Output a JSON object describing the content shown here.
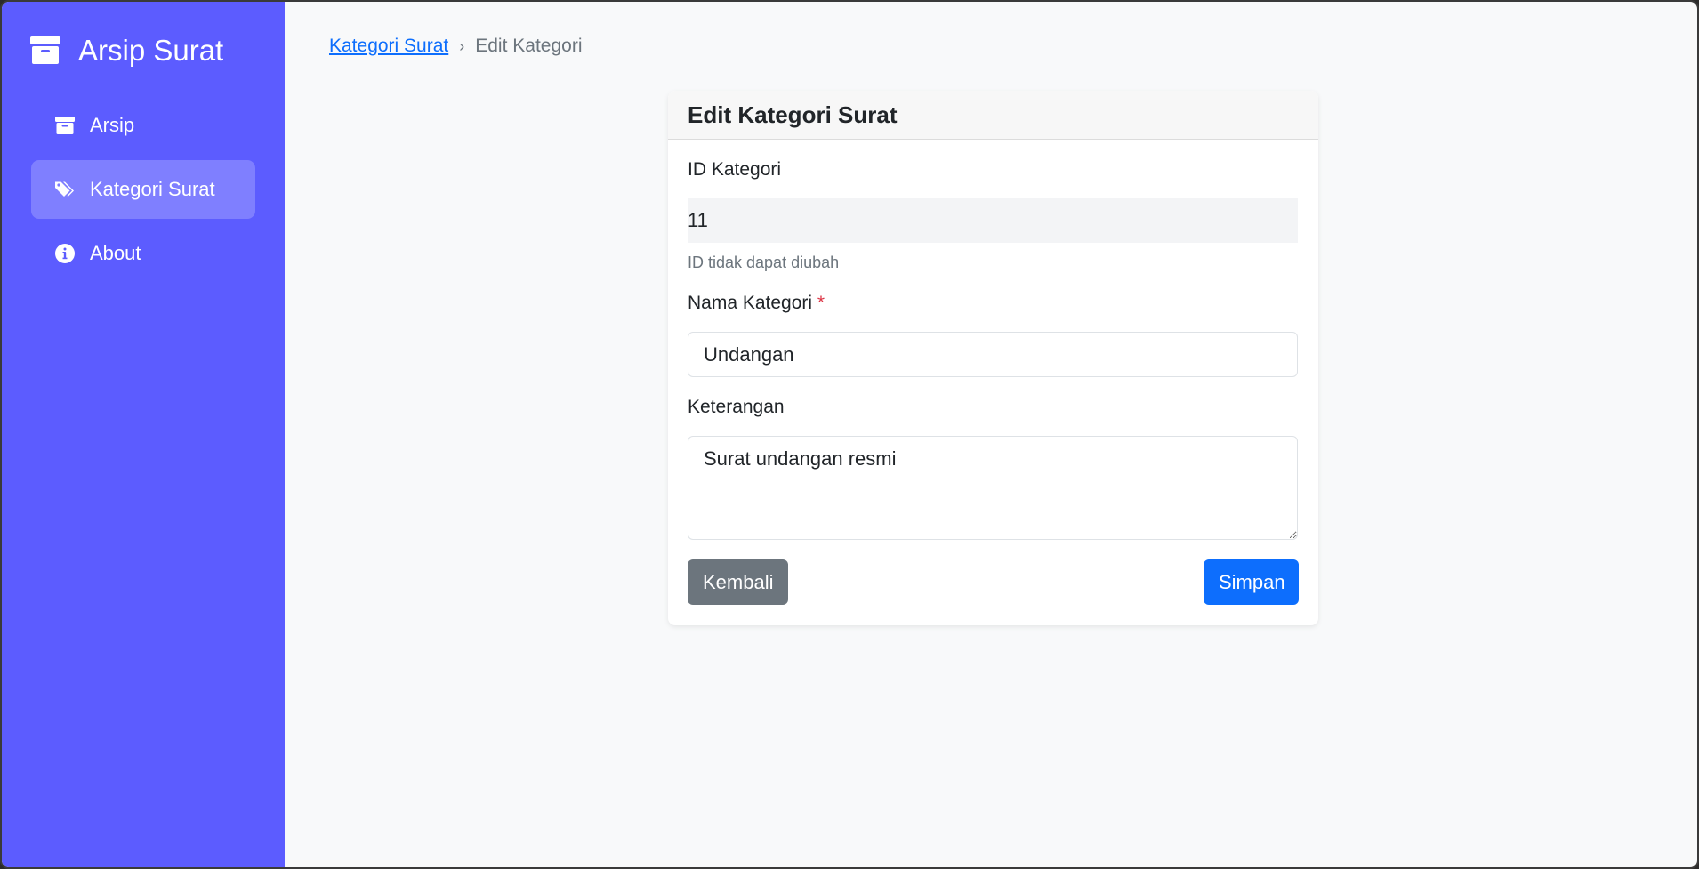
{
  "sidebar": {
    "brand": "Arsip Surat",
    "items": [
      {
        "label": "Arsip",
        "icon": "archive-icon",
        "active": false
      },
      {
        "label": "Kategori Surat",
        "icon": "tags-icon",
        "active": true
      },
      {
        "label": "About",
        "icon": "info-icon",
        "active": false
      }
    ]
  },
  "breadcrumb": {
    "parent": "Kategori Surat",
    "separator": "›",
    "current": "Edit Kategori"
  },
  "card": {
    "title": "Edit Kategori Surat",
    "id_label": "ID Kategori",
    "id_value": "11",
    "id_help": "ID tidak dapat diubah",
    "name_label": "Nama Kategori",
    "name_required": "*",
    "name_value": "Undangan",
    "desc_label": "Keterangan",
    "desc_value": "Surat undangan resmi",
    "back_label": "Kembali",
    "save_label": "Simpan"
  },
  "colors": {
    "sidebar": "#5c5cff",
    "primary": "#0d6efd",
    "secondary": "#6c757d",
    "required": "#dc3545"
  }
}
